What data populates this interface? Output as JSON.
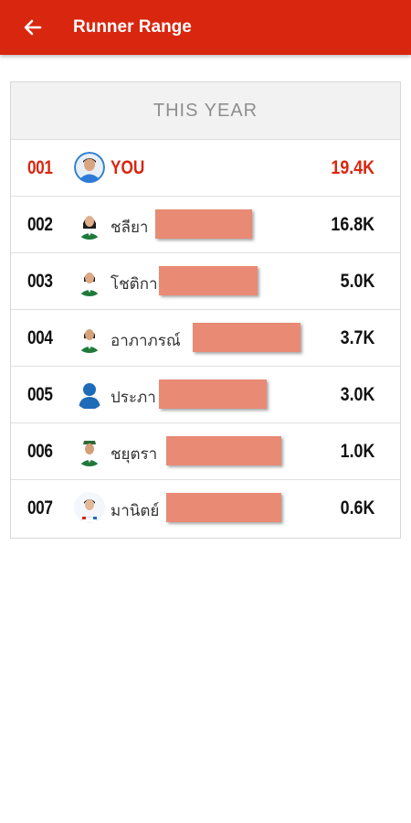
{
  "appbar": {
    "title": "Runner Range",
    "back_icon": "back-arrow-icon"
  },
  "leaderboard": {
    "period_label": "THIS YEAR",
    "accent_color": "#d9260f",
    "rows": [
      {
        "rank": "001",
        "name": "YOU",
        "distance": "19.4K",
        "avatar": "user-photo-avatar"
      },
      {
        "rank": "002",
        "name": "ชลียา",
        "distance": "16.8K",
        "avatar": "user-photo-avatar"
      },
      {
        "rank": "003",
        "name": "โชติกา",
        "distance": "5.0K",
        "avatar": "user-photo-avatar"
      },
      {
        "rank": "004",
        "name": "อาภาภรณ์",
        "distance": "3.7K",
        "avatar": "user-photo-avatar"
      },
      {
        "rank": "005",
        "name": "ประภา",
        "distance": "3.0K",
        "avatar": "default-user-icon"
      },
      {
        "rank": "006",
        "name": "ชยุตรา",
        "distance": "1.0K",
        "avatar": "user-photo-avatar"
      },
      {
        "rank": "007",
        "name": "มานิตย์",
        "distance": "0.6K",
        "avatar": "user-photo-avatar"
      }
    ]
  }
}
